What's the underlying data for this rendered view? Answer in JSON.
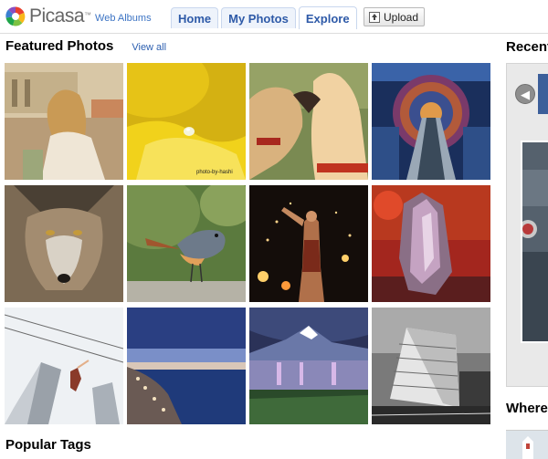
{
  "header": {
    "logo_text": "Picasa",
    "logo_tm": "™",
    "logo_subtitle": "Web Albums",
    "tabs": [
      {
        "label": "Home"
      },
      {
        "label": "My Photos"
      },
      {
        "label": "Explore",
        "active": true
      }
    ],
    "upload_label": "Upload"
  },
  "featured": {
    "title": "Featured Photos",
    "view_all": "View all",
    "photos": [
      {
        "subject": "woman on boardwalk"
      },
      {
        "subject": "water droplet on yellow petal",
        "credit": "photo-by-hashi"
      },
      {
        "subject": "two dogs nuzzling"
      },
      {
        "subject": "futuristic escalator tunnel"
      },
      {
        "subject": "wolf portrait"
      },
      {
        "subject": "small bird on rock"
      },
      {
        "subject": "fire performer with sparks"
      },
      {
        "subject": "ice crystal at sunset"
      },
      {
        "subject": "skyscraper with acrobat"
      },
      {
        "subject": "coastal village at dusk"
      },
      {
        "subject": "mountain lake at twilight"
      },
      {
        "subject": "city building in black and white"
      }
    ]
  },
  "popular_tags": {
    "title": "Popular Tags"
  },
  "sidebar": {
    "recent_title": "Recent",
    "where_title": "Where"
  },
  "colors": {
    "link": "#2c5fb0",
    "tab_text": "#2e5aa8",
    "tab_bg": "#eef3fb"
  },
  "icons": {
    "upload": "upload-icon",
    "prev": "left-arrow-icon"
  }
}
